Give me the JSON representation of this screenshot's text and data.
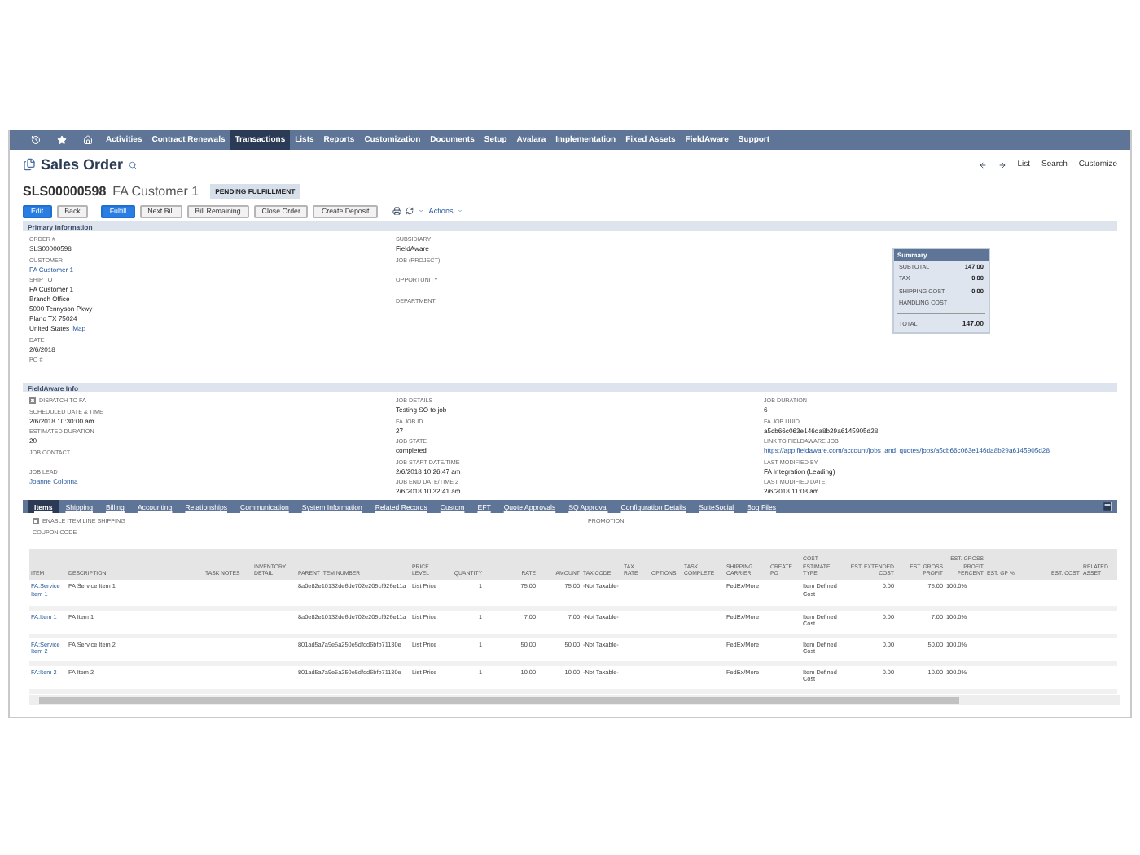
{
  "nav": {
    "items": [
      {
        "label": "Activities",
        "selected": false
      },
      {
        "label": "Contract Renewals",
        "selected": false
      },
      {
        "label": "Transactions",
        "selected": true
      },
      {
        "label": "Lists",
        "selected": false
      },
      {
        "label": "Reports",
        "selected": false
      },
      {
        "label": "Customization",
        "selected": false
      },
      {
        "label": "Documents",
        "selected": false
      },
      {
        "label": "Setup",
        "selected": false
      },
      {
        "label": "Avalara",
        "selected": false
      },
      {
        "label": "Implementation",
        "selected": false
      },
      {
        "label": "Fixed Assets",
        "selected": false
      },
      {
        "label": "FieldAware",
        "selected": false
      },
      {
        "label": "Support",
        "selected": false
      }
    ]
  },
  "page": {
    "title": "Sales Order",
    "links": [
      "List",
      "Search",
      "Customize"
    ]
  },
  "record": {
    "number": "SLS00000598",
    "name": "FA Customer 1",
    "status": "PENDING FULFILLMENT"
  },
  "buttons": [
    {
      "label": "Edit",
      "primary": true
    },
    {
      "label": "Back",
      "primary": false
    },
    {
      "label": "Fulfill",
      "primary": true
    },
    {
      "label": "Next Bill",
      "primary": false
    },
    {
      "label": "Bill Remaining",
      "primary": false
    },
    {
      "label": "Close Order",
      "primary": false
    },
    {
      "label": "Create Deposit",
      "primary": false
    }
  ],
  "actions_menu": "Actions",
  "primary_info": {
    "title": "Primary Information",
    "columns": [
      [
        {
          "label": "ORDER #",
          "value": "SLS00000598",
          "link": false
        },
        {
          "label": "CUSTOMER",
          "value": "FA Customer 1",
          "link": true
        },
        {
          "label": "SHIP TO",
          "lines": [
            "FA Customer 1",
            "Branch Office",
            "5000 Tennyson Pkwy",
            "Plano TX 75024",
            "United States"
          ],
          "map_link": "Map"
        },
        {
          "label": "DATE",
          "value": "2/6/2018",
          "link": false
        },
        {
          "label": "PO #"
        }
      ],
      [
        {
          "label": "SUBSIDIARY",
          "value": "FieldAware",
          "link": false
        },
        {
          "label": "JOB (PROJECT)"
        },
        {
          "label": "OPPORTUNITY"
        },
        {
          "label": "DEPARTMENT"
        }
      ]
    ],
    "summary": {
      "title": "Summary",
      "rows": [
        {
          "label": "SUBTOTAL",
          "value": "147.00"
        },
        {
          "label": "TAX",
          "value": "0.00"
        },
        {
          "label": "SHIPPING COST",
          "value": "0.00"
        },
        {
          "label": "HANDLING COST"
        }
      ],
      "total": {
        "label": "TOTAL",
        "value": "147.00"
      }
    }
  },
  "fieldaware_info": {
    "title": "FieldAware Info",
    "columns": [
      [
        {
          "kind": "checkbox",
          "label": "DISPATCH TO FA",
          "checked": true
        },
        {
          "label": "SCHEDULED DATE & TIME",
          "value": "2/6/2018 10:30:00 am",
          "link": false
        },
        {
          "label": "ESTIMATED DURATION",
          "value": "20",
          "link": false
        },
        {
          "label": "JOB CONTACT"
        },
        {
          "label": "JOB LEAD",
          "value": "Joanne Colonna",
          "link": true
        }
      ],
      [
        {
          "label": "JOB DETAILS",
          "value": "Testing SO to job",
          "link": false
        },
        {
          "label": "FA JOB ID",
          "value": "27",
          "link": false
        },
        {
          "label": "JOB STATE",
          "value": "completed",
          "link": false
        },
        {
          "label": "JOB START DATE/TIME",
          "value": "2/6/2018 10:26:47 am",
          "link": false
        },
        {
          "label": "JOB END DATE/TIME 2",
          "value": "2/6/2018 10:32:41 am",
          "link": false
        }
      ],
      [
        {
          "label": "JOB DURATION",
          "value": "6",
          "link": false
        },
        {
          "label": "FA JOB UUID",
          "value": "a5cb66c063e146da8b29a6145905d28",
          "link": false
        },
        {
          "label": "LINK TO FIELDAWARE JOB",
          "value": "https://app.fieldaware.com/account/jobs_and_quotes/jobs/a5cb66c063e146da8b29a6145905d28",
          "link": true
        },
        {
          "label": "LAST MODIFIED BY",
          "value": "FA Integration (Leading)",
          "link": false
        },
        {
          "label": "LAST MODIFIED DATE",
          "value": "2/6/2018 11:03 am",
          "link": false
        }
      ]
    ]
  },
  "subtabs": [
    {
      "label": "Items",
      "selected": true
    },
    {
      "label": "Shipping",
      "selected": false
    },
    {
      "label": "Billing",
      "selected": false
    },
    {
      "label": "Accounting",
      "selected": false
    },
    {
      "label": "Relationships",
      "selected": false
    },
    {
      "label": "Communication",
      "selected": false
    },
    {
      "label": "System Information",
      "selected": false
    },
    {
      "label": "Related Records",
      "selected": false
    },
    {
      "label": "Custom",
      "selected": false
    },
    {
      "label": "EFT",
      "selected": false
    },
    {
      "label": "Quote Approvals",
      "selected": false
    },
    {
      "label": "SQ Approval",
      "selected": false
    },
    {
      "label": "Configuration Details",
      "selected": false
    },
    {
      "label": "SuiteSocial",
      "selected": false
    },
    {
      "label": "Bog Files",
      "selected": false
    }
  ],
  "item_options": {
    "line_shipping": {
      "label": "ENABLE ITEM LINE SHIPPING",
      "checked": false
    },
    "coupon_code": "COUPON CODE",
    "promotion": "PROMOTION"
  },
  "table": {
    "columns": [
      "ITEM",
      "DESCRIPTION",
      "TASK NOTES",
      "INVENTORY DETAIL",
      "PARENT ITEM NUMBER",
      "PRICE LEVEL",
      "QUANTITY",
      "RATE",
      "AMOUNT",
      "TAX CODE",
      "TAX RATE",
      "OPTIONS",
      "TASK COMPLETE",
      "SHIPPING CARRIER",
      "CREATE PO",
      "COST ESTIMATE TYPE",
      "EST. EXTENDED COST",
      "EST. GROSS PROFIT",
      "EST. GROSS PROFIT PERCENT",
      "EST. GP %",
      "EST. COST",
      "RELATED ASSET"
    ],
    "rows": [
      {
        "item": "FA:Service Item 1",
        "description": "FA Service Item 1",
        "parent_item_number": "8a0e82e10132de6de702e205cf926e11a",
        "price_level": "List Price",
        "quantity": "1",
        "rate": "75.00",
        "amount": "75.00",
        "tax_code": "-Not Taxable-",
        "shipping_carrier": "FedEx/More",
        "cost_estimate_type": "Item Defined Cost",
        "est_extended_cost": "0.00",
        "est_gross_profit": "75.00",
        "est_gross_profit_percent": "100.0%"
      },
      {
        "item": "FA:Item 1",
        "description": "FA Item 1",
        "parent_item_number": "8a0e82e10132de6de702e205cf926e11a",
        "price_level": "List Price",
        "quantity": "1",
        "rate": "7.00",
        "amount": "7.00",
        "tax_code": "-Not Taxable-",
        "shipping_carrier": "FedEx/More",
        "cost_estimate_type": "Item Defined Cost",
        "est_extended_cost": "0.00",
        "est_gross_profit": "7.00",
        "est_gross_profit_percent": "100.0%"
      },
      {
        "item": "FA:Service Item 2",
        "description": "FA Service Item 2",
        "parent_item_number": "801ad5a7a9e5a250e5dfdd6bfb71130e",
        "price_level": "List Price",
        "quantity": "1",
        "rate": "50.00",
        "amount": "50.00",
        "tax_code": "-Not Taxable-",
        "shipping_carrier": "FedEx/More",
        "cost_estimate_type": "Item Defined Cost",
        "est_extended_cost": "0.00",
        "est_gross_profit": "50.00",
        "est_gross_profit_percent": "100.0%"
      },
      {
        "item": "FA:Item 2",
        "description": "FA Item 2",
        "parent_item_number": "801ad5a7a9e5a250e5dfdd6bfb71130e",
        "price_level": "List Price",
        "quantity": "1",
        "rate": "10.00",
        "amount": "10.00",
        "tax_code": "-Not Taxable-",
        "shipping_carrier": "FedEx/More",
        "cost_estimate_type": "Item Defined Cost",
        "est_extended_cost": "0.00",
        "est_gross_profit": "10.00",
        "est_gross_profit_percent": "100.0%"
      }
    ]
  }
}
